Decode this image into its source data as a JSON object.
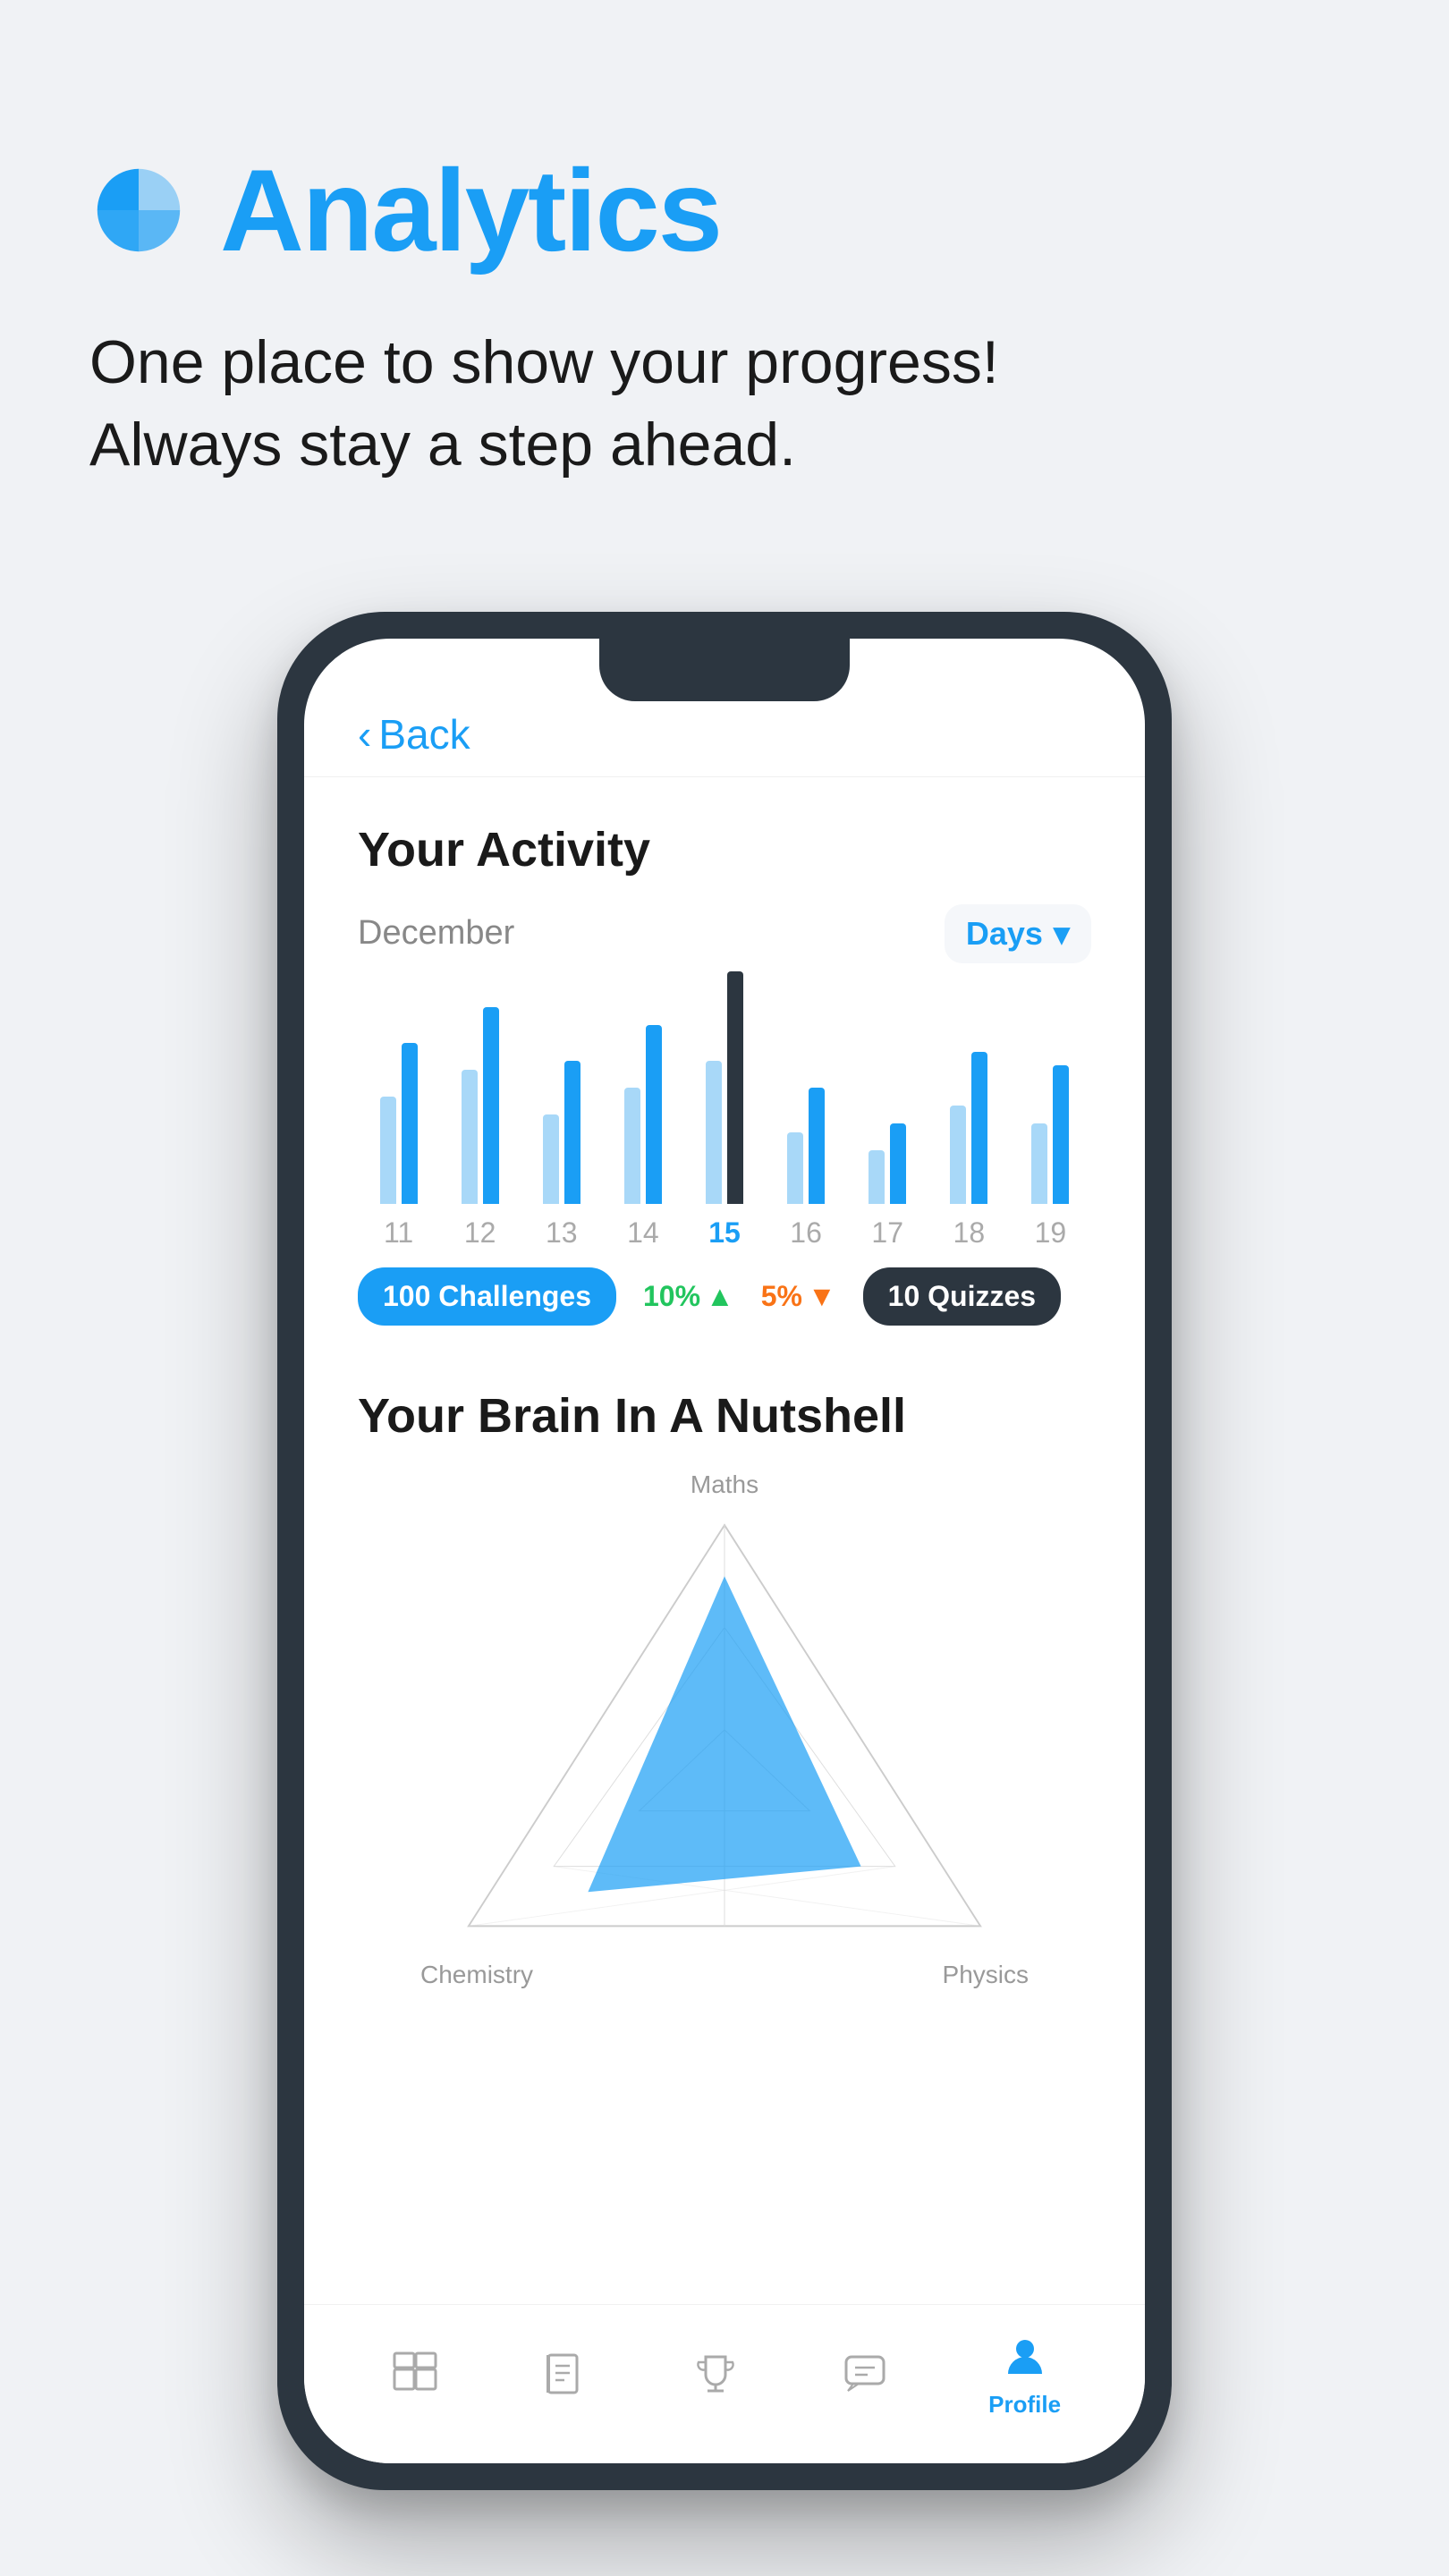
{
  "hero": {
    "title": "Analytics",
    "subtitle_line1": "One place to show your progress!",
    "subtitle_line2": "Always stay a step ahead.",
    "icon_label": "analytics-pie-icon"
  },
  "phone": {
    "back_label": "Back",
    "activity": {
      "title": "Your Activity",
      "month": "December",
      "selector": "Days",
      "bars": [
        {
          "day": "11",
          "heights": [
            120,
            180
          ],
          "active": false
        },
        {
          "day": "12",
          "heights": [
            160,
            220
          ],
          "active": false
        },
        {
          "day": "13",
          "heights": [
            100,
            150
          ],
          "active": false
        },
        {
          "day": "14",
          "heights": [
            140,
            200
          ],
          "active": false
        },
        {
          "day": "15",
          "heights": [
            200,
            260
          ],
          "active": true
        },
        {
          "day": "16",
          "heights": [
            90,
            130
          ],
          "active": false
        },
        {
          "day": "17",
          "heights": [
            70,
            100
          ],
          "active": false
        },
        {
          "day": "18",
          "heights": [
            130,
            180
          ],
          "active": false
        },
        {
          "day": "19",
          "heights": [
            110,
            160
          ],
          "active": false
        }
      ],
      "stats": {
        "challenges_badge": "100 Challenges",
        "challenges_change": "10%",
        "challenges_direction": "up",
        "quizzes_change": "5%",
        "quizzes_direction": "down",
        "quizzes_badge": "10 Quizzes"
      }
    },
    "brain": {
      "title": "Your Brain In A Nutshell",
      "axes": {
        "top": "Maths",
        "bottom_left": "Chemistry",
        "bottom_right": "Physics"
      }
    },
    "nav": {
      "items": [
        {
          "label": "Home",
          "active": false,
          "icon": "home-icon"
        },
        {
          "label": "Book",
          "active": false,
          "icon": "book-icon"
        },
        {
          "label": "Trophy",
          "active": false,
          "icon": "trophy-icon"
        },
        {
          "label": "Chat",
          "active": false,
          "icon": "chat-icon"
        },
        {
          "label": "Profile",
          "active": true,
          "icon": "profile-icon"
        }
      ]
    }
  }
}
